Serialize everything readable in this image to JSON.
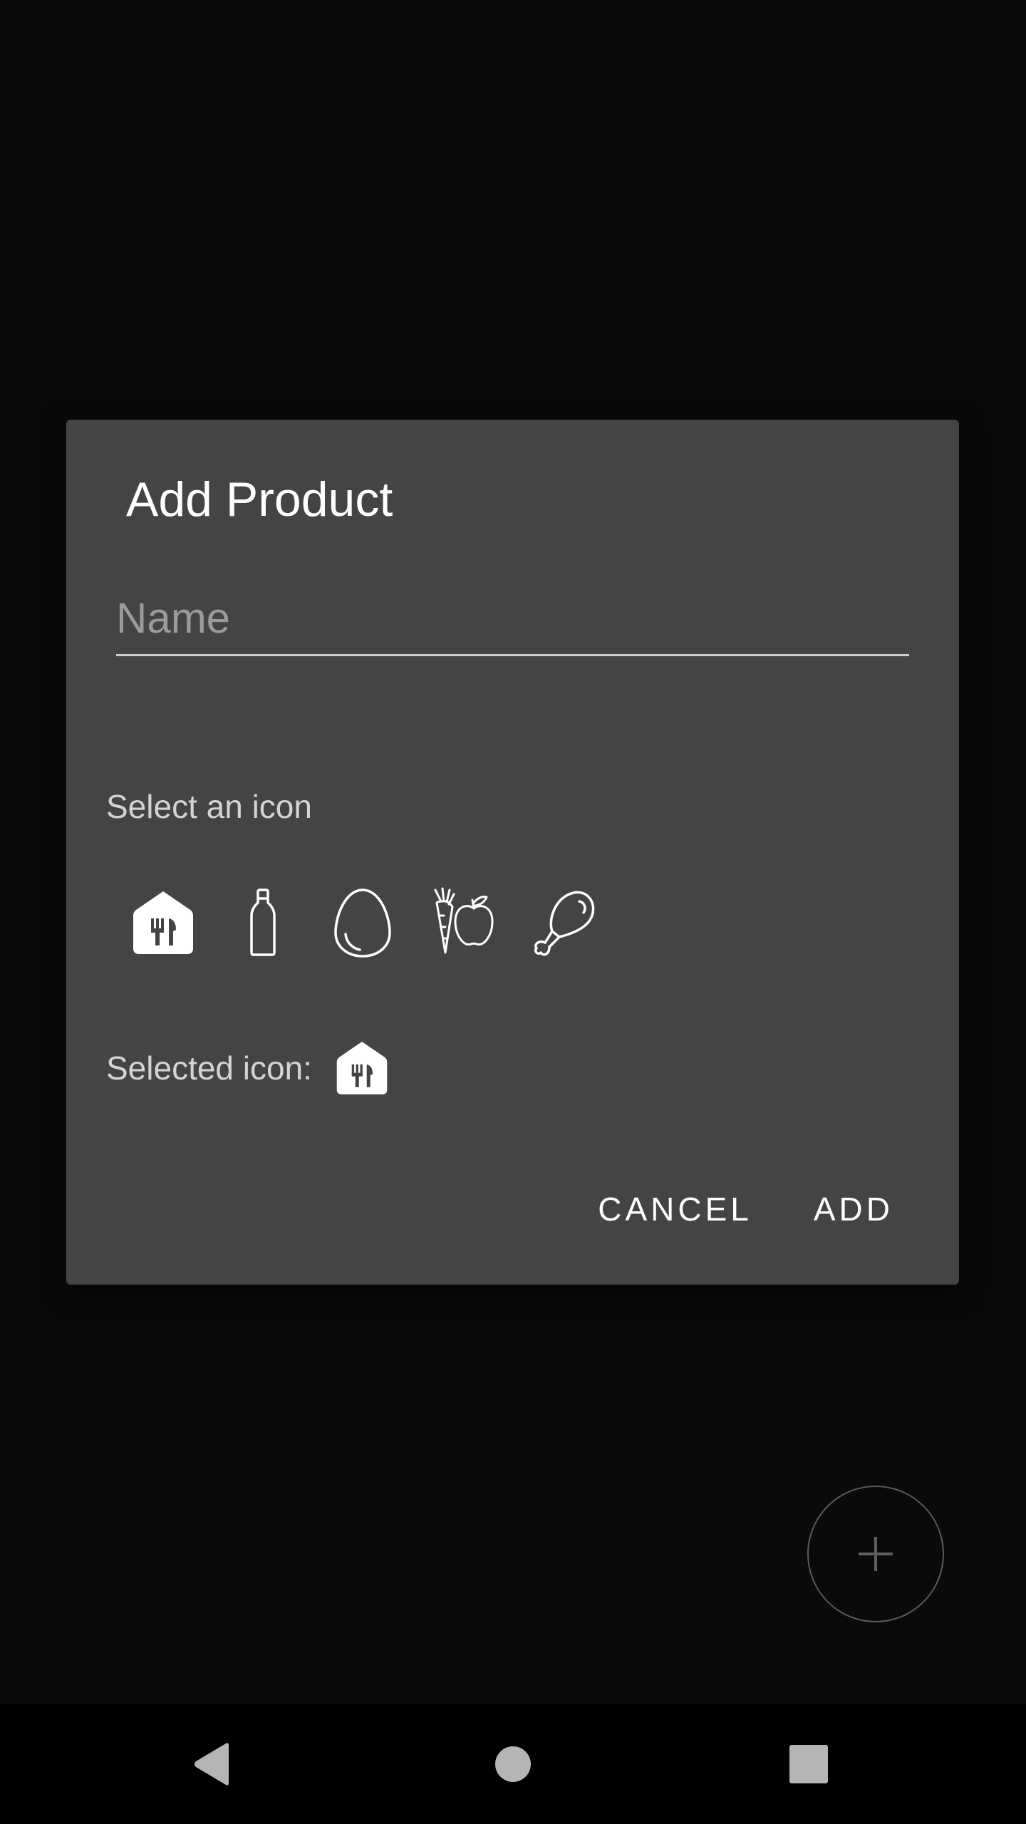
{
  "dialog": {
    "title": "Add Product",
    "name_placeholder": "Name",
    "name_value": "",
    "select_icon_label": "Select an icon",
    "icon_options": [
      "restaurant-icon",
      "bottle-icon",
      "egg-icon",
      "vegetables-fruits-icon",
      "chicken-leg-icon"
    ],
    "selected_icon_label": "Selected icon:",
    "selected_icon": "restaurant-icon",
    "cancel_label": "CANCEL",
    "add_label": "ADD"
  },
  "fab": {
    "icon": "plus-icon"
  },
  "navbar": {
    "back_icon": "back-triangle-icon",
    "home_icon": "home-circle-icon",
    "recents_icon": "recents-square-icon"
  },
  "colors": {
    "background": "#0a0a0a",
    "dialog": "#444444",
    "text_primary": "#ffffff",
    "text_secondary": "#d4d4d4",
    "placeholder": "#9a9a9a"
  }
}
